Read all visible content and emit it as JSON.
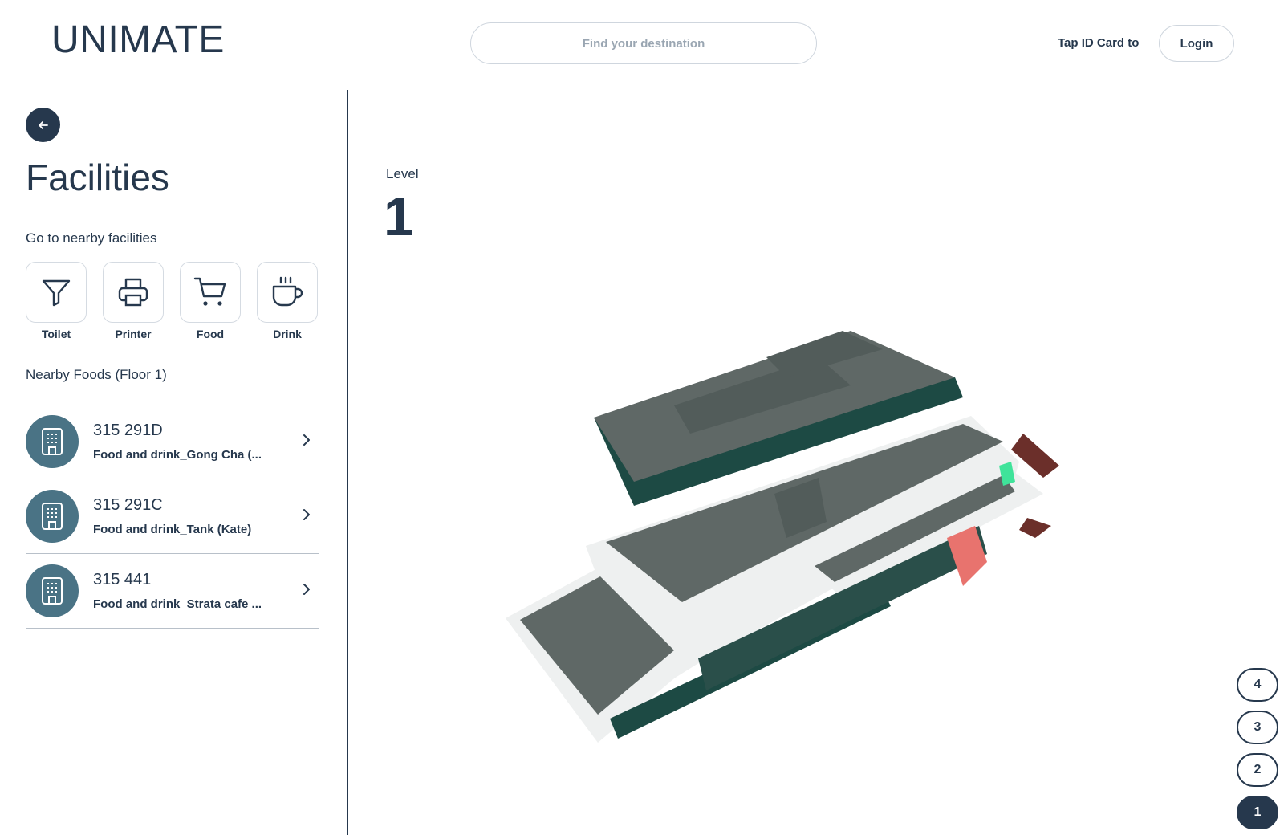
{
  "header": {
    "logo": "UNIMATE",
    "search_placeholder": "Find your destination",
    "tap_label": "Tap ID Card to",
    "login_label": "Login"
  },
  "sidebar": {
    "back_icon": "arrow-left-icon",
    "title": "Facilities",
    "nearby_heading": "Go to nearby facilities",
    "facilities": [
      {
        "label": "Toilet",
        "icon": "filter-icon"
      },
      {
        "label": "Printer",
        "icon": "printer-icon"
      },
      {
        "label": "Food",
        "icon": "cart-icon"
      },
      {
        "label": "Drink",
        "icon": "cup-icon"
      }
    ],
    "foods_heading": "Nearby Foods (Floor 1)",
    "foods": [
      {
        "room": "315 291D",
        "name": "Food and drink_Gong Cha (...",
        "icon": "building-icon"
      },
      {
        "room": "315 291C",
        "name": "Food and drink_Tank (Kate)",
        "icon": "building-icon"
      },
      {
        "room": "315 441",
        "name": "Food and drink_Strata cafe ...",
        "icon": "building-icon"
      }
    ]
  },
  "map": {
    "level_label": "Level",
    "level_value": "1",
    "floors": [
      "4",
      "3",
      "2",
      "1"
    ],
    "active_floor": "1"
  },
  "colors": {
    "primary": "#26384d",
    "avatar": "#4a7385",
    "building_roof": "#5f6866",
    "building_wall": "#f2f3f3",
    "glass": "#1d4a44",
    "highlight_red": "#e8736e",
    "highlight_green": "#3fe39a"
  }
}
